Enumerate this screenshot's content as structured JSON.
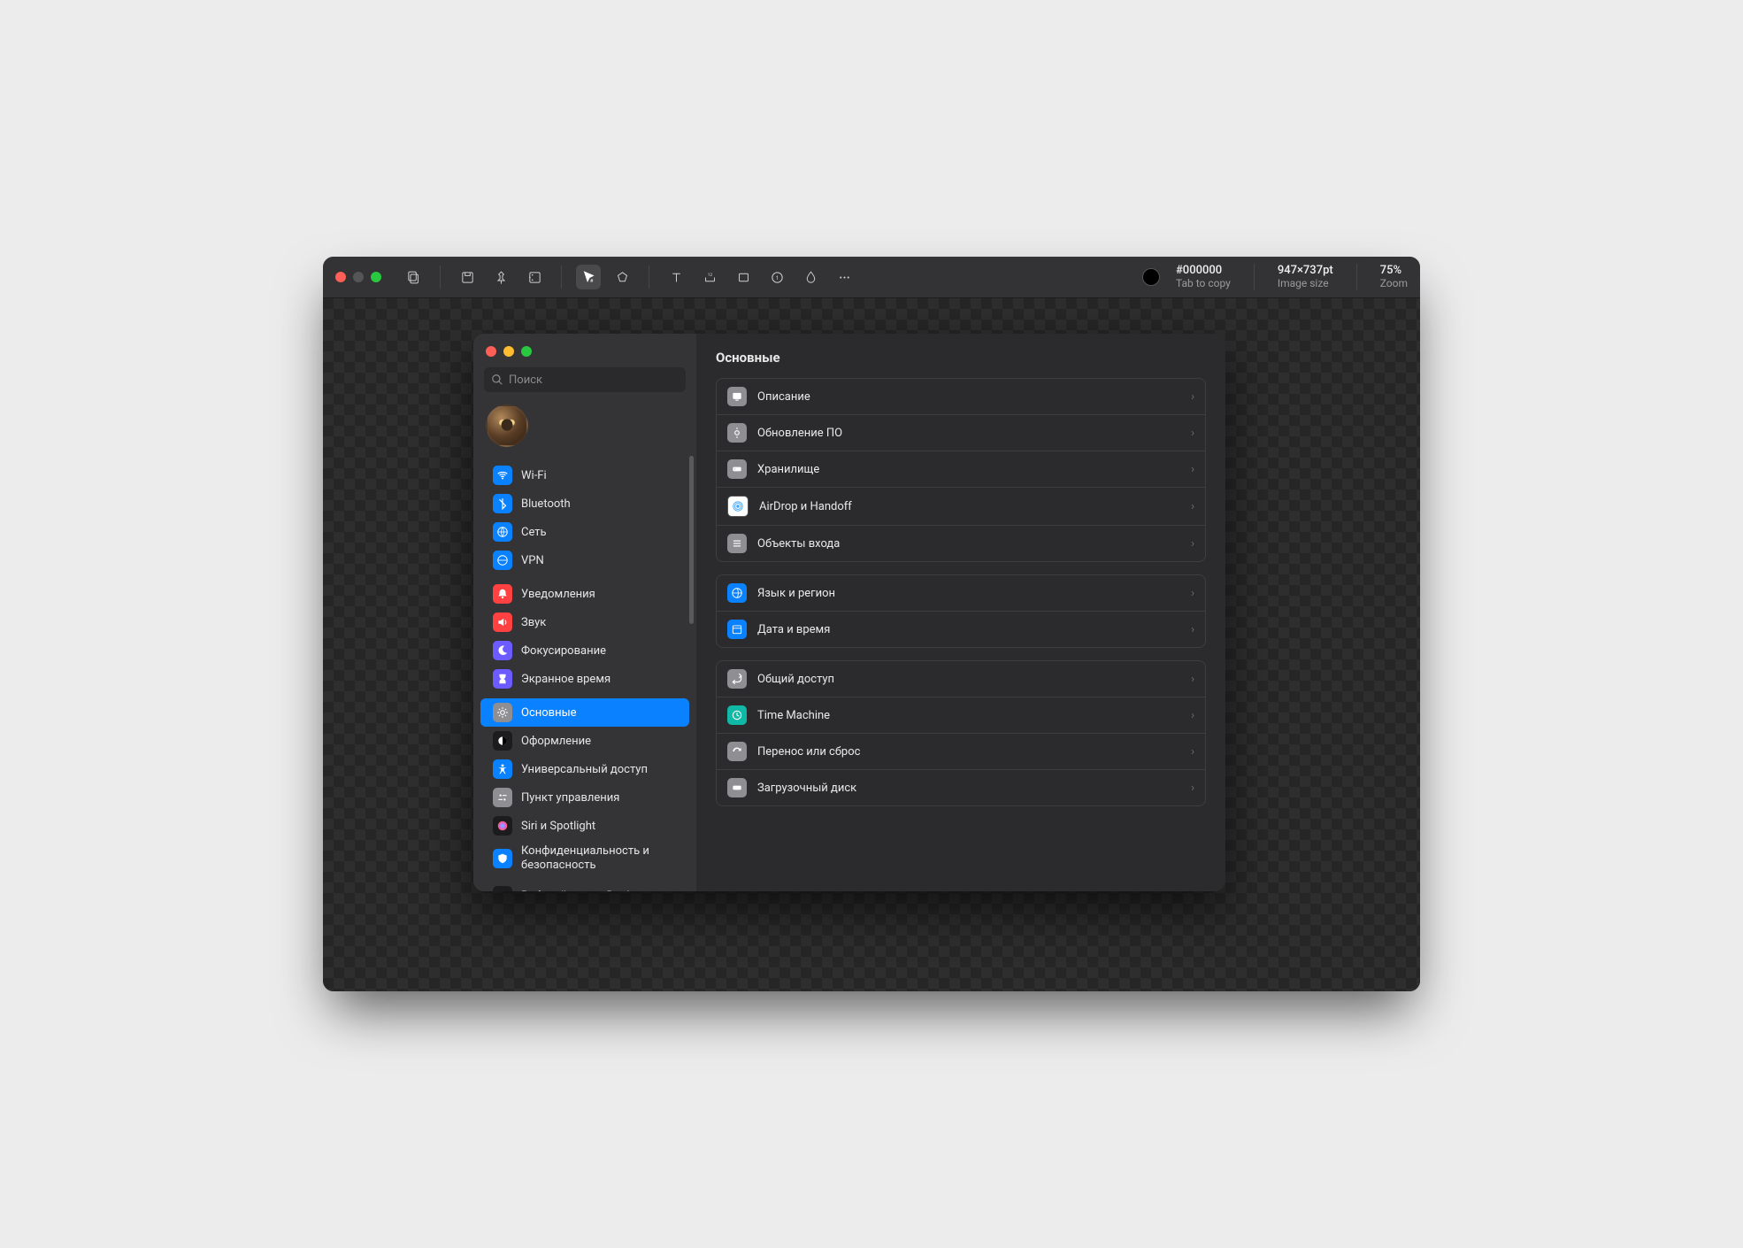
{
  "editor": {
    "color_hex": "#000000",
    "color_hint": "Tab to copy",
    "image_size_value": "947×737pt",
    "image_size_label": "Image size",
    "zoom_value": "75%",
    "zoom_label": "Zoom"
  },
  "settings": {
    "search_placeholder": "Поиск",
    "title": "Основные",
    "sidebar_groups": [
      {
        "items": [
          {
            "id": "wifi",
            "label": "Wi-Fi",
            "color": "#0a82ff"
          },
          {
            "id": "bluetooth",
            "label": "Bluetooth",
            "color": "#0a82ff"
          },
          {
            "id": "network",
            "label": "Сеть",
            "color": "#0a82ff"
          },
          {
            "id": "vpn",
            "label": "VPN",
            "color": "#0a82ff"
          }
        ]
      },
      {
        "items": [
          {
            "id": "notifications",
            "label": "Уведомления",
            "color": "#ff4141"
          },
          {
            "id": "sound",
            "label": "Звук",
            "color": "#ff4141"
          },
          {
            "id": "focus",
            "label": "Фокусирование",
            "color": "#6c5cff"
          },
          {
            "id": "screentime",
            "label": "Экранное время",
            "color": "#6c5cff"
          }
        ]
      },
      {
        "items": [
          {
            "id": "general",
            "label": "Основные",
            "color": "#8e8e93",
            "selected": true
          },
          {
            "id": "appearance",
            "label": "Оформление",
            "color": "#1c1c1e"
          },
          {
            "id": "accessibility",
            "label": "Универсальный доступ",
            "color": "#0a82ff"
          },
          {
            "id": "controlcenter",
            "label": "Пункт управления",
            "color": "#8e8e93"
          },
          {
            "id": "siri",
            "label": "Siri и Spotlight",
            "color": "#1c1c1e"
          },
          {
            "id": "privacy",
            "label": "Конфиденциальность и безопасность",
            "color": "#0a82ff",
            "multi": true
          }
        ]
      },
      {
        "items": [
          {
            "id": "desktop",
            "label": "Рабочий стол и Dock",
            "color": "#1c1c1e"
          }
        ]
      }
    ],
    "content_groups": [
      {
        "rows": [
          {
            "id": "about",
            "label": "Описание",
            "color": "#8e8e93"
          },
          {
            "id": "update",
            "label": "Обновление ПО",
            "color": "#8e8e93"
          },
          {
            "id": "storage",
            "label": "Хранилище",
            "color": "#8e8e93"
          },
          {
            "id": "airdrop",
            "label": "AirDrop и Handoff",
            "color": "#ffffff"
          },
          {
            "id": "login",
            "label": "Объекты входа",
            "color": "#8e8e93"
          }
        ]
      },
      {
        "rows": [
          {
            "id": "language",
            "label": "Язык и регион",
            "color": "#0a82ff"
          },
          {
            "id": "datetime",
            "label": "Дата и время",
            "color": "#0a82ff"
          }
        ]
      },
      {
        "rows": [
          {
            "id": "sharing",
            "label": "Общий доступ",
            "color": "#8e8e93"
          },
          {
            "id": "timemachine",
            "label": "Time Machine",
            "color": "#10b9a6"
          },
          {
            "id": "transfer",
            "label": "Перенос или сброс",
            "color": "#8e8e93"
          },
          {
            "id": "startup",
            "label": "Загрузочный диск",
            "color": "#8e8e93"
          }
        ]
      }
    ]
  }
}
